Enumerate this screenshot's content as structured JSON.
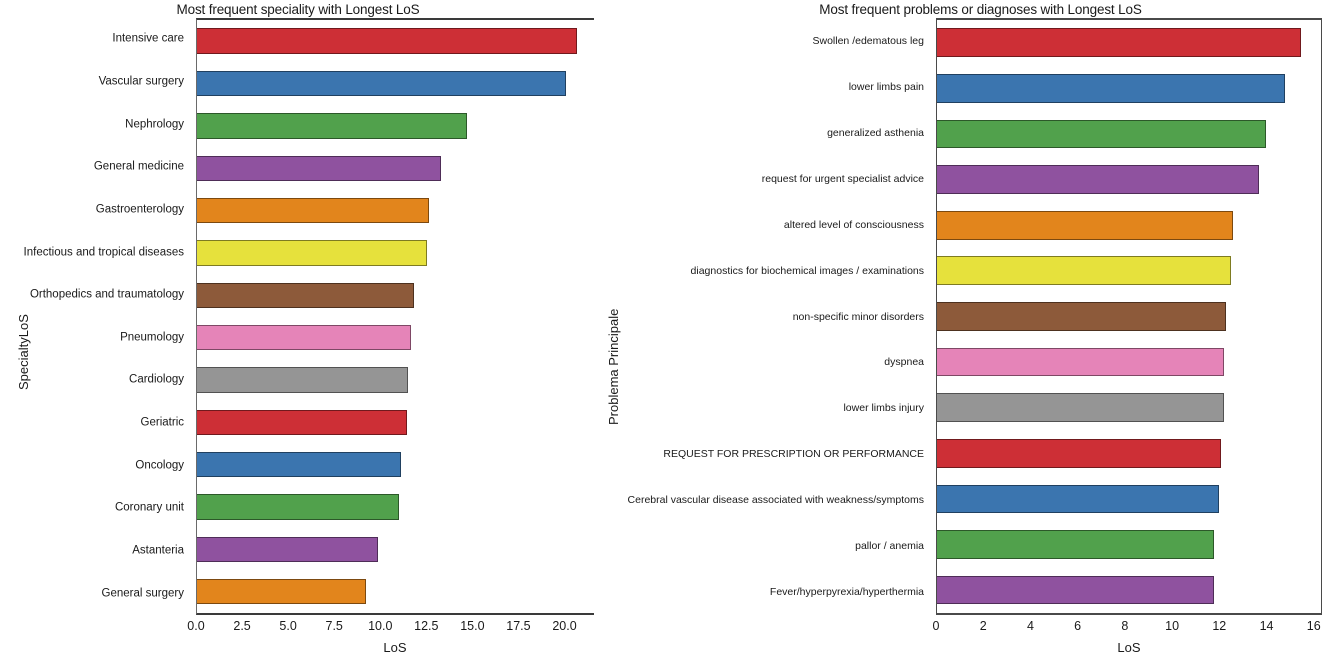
{
  "chart_data": [
    {
      "type": "bar",
      "orientation": "horizontal",
      "title": "Most frequent speciality with Longest LoS",
      "xlabel": "LoS",
      "ylabel": "SpecialtyLoS",
      "xlim": [
        0,
        21.6
      ],
      "xticks": [
        0.0,
        2.5,
        5.0,
        7.5,
        10.0,
        12.5,
        15.0,
        17.5,
        20.0
      ],
      "xticklabels": [
        "0.0",
        "2.5",
        "5.0",
        "7.5",
        "10.0",
        "12.5",
        "15.0",
        "17.5",
        "20.0"
      ],
      "grid": false,
      "legend": "none",
      "categories": [
        "Intensive care",
        "Vascular surgery",
        "Nephrology",
        "General medicine",
        "Gastroenterology",
        "Infectious and tropical diseases",
        "Orthopedics and traumatology",
        "Pneumology",
        "Cardiology",
        "Geriatric",
        "Oncology",
        "Coronary unit",
        "Astanteria",
        "General surgery"
      ],
      "values": [
        20.7,
        20.1,
        14.7,
        13.3,
        12.6,
        12.5,
        11.8,
        11.65,
        11.5,
        11.4,
        11.1,
        11.0,
        9.85,
        9.2
      ],
      "colors": [
        "#cd2f36",
        "#3b75af",
        "#51a14c",
        "#8f529f",
        "#e2851c",
        "#e6e13c",
        "#8d5a3a",
        "#e584b8",
        "#959595",
        "#cd2f36",
        "#3b75af",
        "#51a14c",
        "#8f529f",
        "#e2851c"
      ]
    },
    {
      "type": "bar",
      "orientation": "horizontal",
      "title": "Most frequent problems or diagnoses with Longest LoS",
      "xlabel": "LoS",
      "ylabel": "Problema Principale",
      "xlim": [
        0,
        16.35
      ],
      "xticks": [
        0,
        2,
        4,
        6,
        8,
        10,
        12,
        14,
        16
      ],
      "xticklabels": [
        "0",
        "2",
        "4",
        "6",
        "8",
        "10",
        "12",
        "14",
        "16"
      ],
      "grid": false,
      "legend": "none",
      "categories": [
        "Swollen /edematous leg",
        "lower limbs pain",
        "generalized asthenia",
        "request for urgent specialist advice",
        "altered level of consciousness",
        "diagnostics for biochemical images / examinations",
        "non-specific minor disorders",
        "dyspnea",
        "lower limbs injury",
        "REQUEST FOR PRESCRIPTION OR PERFORMANCE",
        "Cerebral vascular disease associated with weakness/symptoms",
        "pallor / anemia",
        "Fever/hyperpyrexia/hyperthermia"
      ],
      "values": [
        15.5,
        14.8,
        14.0,
        13.7,
        12.6,
        12.5,
        12.3,
        12.2,
        12.2,
        12.1,
        12.0,
        11.8,
        11.8
      ],
      "colors": [
        "#cd2f36",
        "#3b75af",
        "#51a14c",
        "#8f529f",
        "#e2851c",
        "#e6e13c",
        "#8d5a3a",
        "#e584b8",
        "#959595",
        "#cd2f36",
        "#3b75af",
        "#51a14c",
        "#8f529f"
      ]
    }
  ]
}
